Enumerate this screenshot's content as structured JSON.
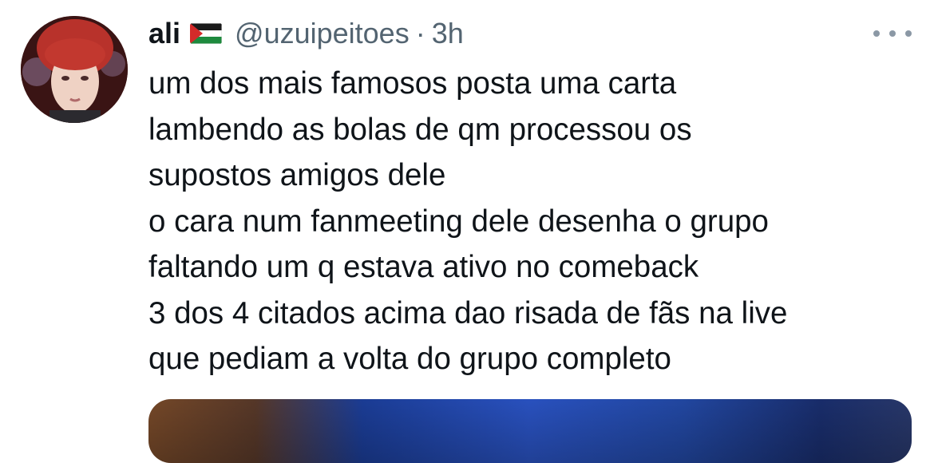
{
  "tweet": {
    "display_name": "ali",
    "flag_icon": "palestine-flag-icon",
    "handle": "@uzuipeitoes",
    "separator": "·",
    "time": "3h",
    "more_icon": "more-options-icon",
    "text_lines": [
      "um dos mais famosos posta uma carta",
      "lambendo as bolas de qm processou os",
      "supostos amigos dele",
      "o cara num fanmeeting dele desenha o grupo",
      "faltando um q estava ativo no comeback",
      "3 dos 4 citados acima dao risada de fãs na live",
      "que pediam a volta do grupo completo"
    ]
  },
  "colors": {
    "text_primary": "#0f1419",
    "text_secondary": "#536471",
    "icon_gray": "#8b98a5",
    "background": "#ffffff"
  }
}
